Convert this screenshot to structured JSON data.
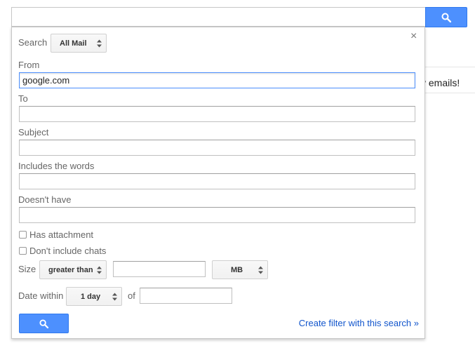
{
  "background": {
    "partial_text": "v emails!"
  },
  "search": {
    "query": "",
    "button_icon": "search-icon",
    "accent": "#4d90fe"
  },
  "panel": {
    "close_glyph": "×",
    "search_label": "Search",
    "search_scope": "All Mail",
    "from_label": "From",
    "from_value": "google.com",
    "to_label": "To",
    "to_value": "",
    "subject_label": "Subject",
    "subject_value": "",
    "includes_label": "Includes the words",
    "includes_value": "",
    "doesnt_have_label": "Doesn't have",
    "doesnt_have_value": "",
    "has_attachment_label": "Has attachment",
    "has_attachment_checked": false,
    "no_chats_label": "Don't include chats",
    "no_chats_checked": false,
    "size_label": "Size",
    "size_operator": "greater than",
    "size_value": "",
    "size_unit": "MB",
    "date_label": "Date within",
    "date_range": "1 day",
    "of_label": "of",
    "date_value": "",
    "create_filter_link": "Create filter with this search »"
  }
}
